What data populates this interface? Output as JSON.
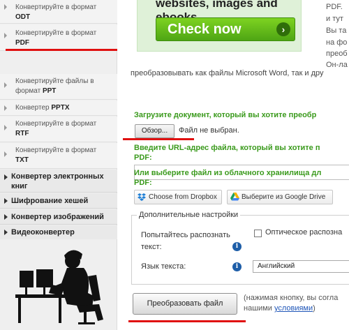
{
  "sidebar": {
    "sub_items": [
      {
        "label": "Конвертируйте в формат",
        "format": "ODT"
      },
      {
        "label": "Конвертируйте в формат",
        "format": "PDF"
      },
      {
        "label": "Конвертируйте файлы в формат",
        "format": "PPT"
      },
      {
        "label": "Конвертер",
        "format": "PPTX"
      },
      {
        "label": "Конвертируйте в формат",
        "format": "RTF"
      },
      {
        "label": "Конвертируйте в формат",
        "format": "TXT"
      }
    ],
    "categories": [
      {
        "line1": "Конвертер электронных",
        "line2": "книг"
      },
      {
        "line1": "Шифрование хешей",
        "line2": ""
      },
      {
        "line1": "Конвертер изображений",
        "line2": ""
      },
      {
        "line1": "Видеоконвертер",
        "line2": ""
      }
    ]
  },
  "banner": {
    "title": "websites, images and ebooks.",
    "button": "Check now",
    "arrow": "›"
  },
  "right_text": [
    "PDF. ",
    "и тут",
    "Вы та",
    "на фо",
    "преоб",
    "Он-ла"
  ],
  "intro_line": "преобразовывать как файлы Microsoft Word, так и дру",
  "upload": {
    "label": "Загрузите документ, который вы хотите преобр",
    "browse": "Обзор...",
    "no_file": "Файл не выбран."
  },
  "url_section": {
    "label_line1": "Введите URL-адрес файла, который вы хотите п",
    "label_line2": "PDF:",
    "value": ""
  },
  "cloud_section": {
    "label_line1": "Или выберите файл из облачного хранилища дл",
    "label_line2": "PDF:",
    "dropbox": "Choose from Dropbox",
    "gdrive": "Выберите из Google Drive"
  },
  "options": {
    "legend": "Дополнительные настройки",
    "ocr_label_line1": "Попытайтесь распознать",
    "ocr_label_line2": "текст:",
    "ocr_checkbox": "Оптическое распозна",
    "ocr_checked": false,
    "lang_label": "Язык текста:",
    "lang_value": "Английский",
    "info": "i"
  },
  "convert": {
    "button": "Преобразовать файл",
    "note_line1": "(нажимая кнопку, вы согла",
    "note_line2_prefix": "нашими ",
    "note_link": "условиями",
    "note_line2_suffix": ")"
  },
  "colors": {
    "highlight_red": "#e01010",
    "green_label": "#3a9a1c",
    "check_green": "#5bb51a",
    "info_blue": "#1e5ea8"
  }
}
